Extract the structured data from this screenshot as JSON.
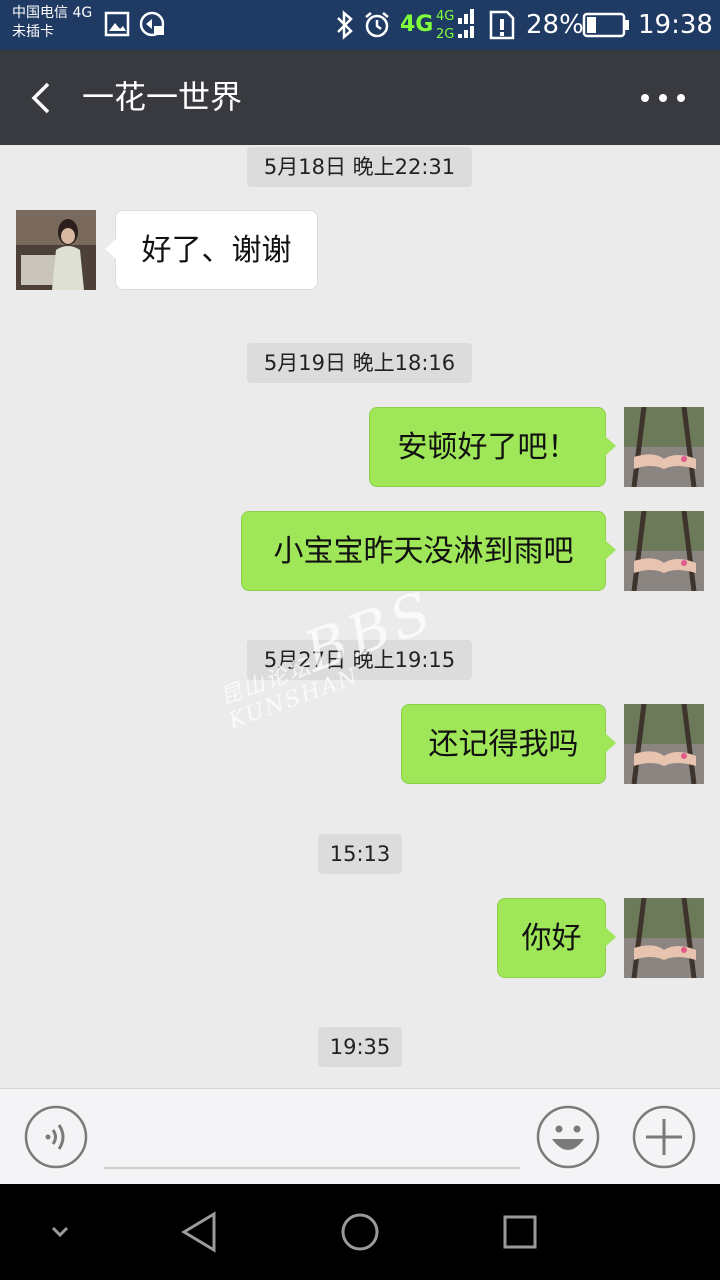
{
  "status_bar": {
    "carrier_line1": "中国电信 4G",
    "carrier_line2": "未插卡",
    "network": "4G",
    "battery": "28%",
    "time": "19:38"
  },
  "header": {
    "title": "一花一世界",
    "back_icon": "chevron-left-icon",
    "more_icon": "more-dots-icon"
  },
  "messages": [
    {
      "type": "time",
      "text": "5月18日 晚上22:31"
    },
    {
      "type": "msg",
      "side": "left",
      "text": "好了、谢谢"
    },
    {
      "type": "time",
      "text": "5月19日 晚上18:16"
    },
    {
      "type": "msg",
      "side": "right",
      "text": "安顿好了吧！"
    },
    {
      "type": "msg",
      "side": "right",
      "text": "小宝宝昨天没淋到雨吧"
    },
    {
      "type": "time",
      "text": "5月27日 晚上19:15"
    },
    {
      "type": "msg",
      "side": "right",
      "text": "还记得我吗"
    },
    {
      "type": "time",
      "text": "15:13"
    },
    {
      "type": "msg",
      "side": "right",
      "text": "你好"
    },
    {
      "type": "time",
      "text": "19:35"
    }
  ],
  "watermark": {
    "small": "昆山论坛",
    "brand": "BBS",
    "latin": "KUNSHAN"
  },
  "input_bar": {
    "voice_icon": "voice-icon",
    "emoji_icon": "emoji-icon",
    "plus_icon": "plus-icon"
  },
  "nav_bar": {
    "icons": [
      "collapse-icon",
      "back-triangle-icon",
      "home-circle-icon",
      "recents-square-icon"
    ]
  },
  "colors": {
    "status_bar": "#1f3a63",
    "title_bar": "#393a3f",
    "chat_bg": "#ebebeb",
    "bubble_sent": "#9fe658",
    "bubble_received": "#ffffff"
  }
}
